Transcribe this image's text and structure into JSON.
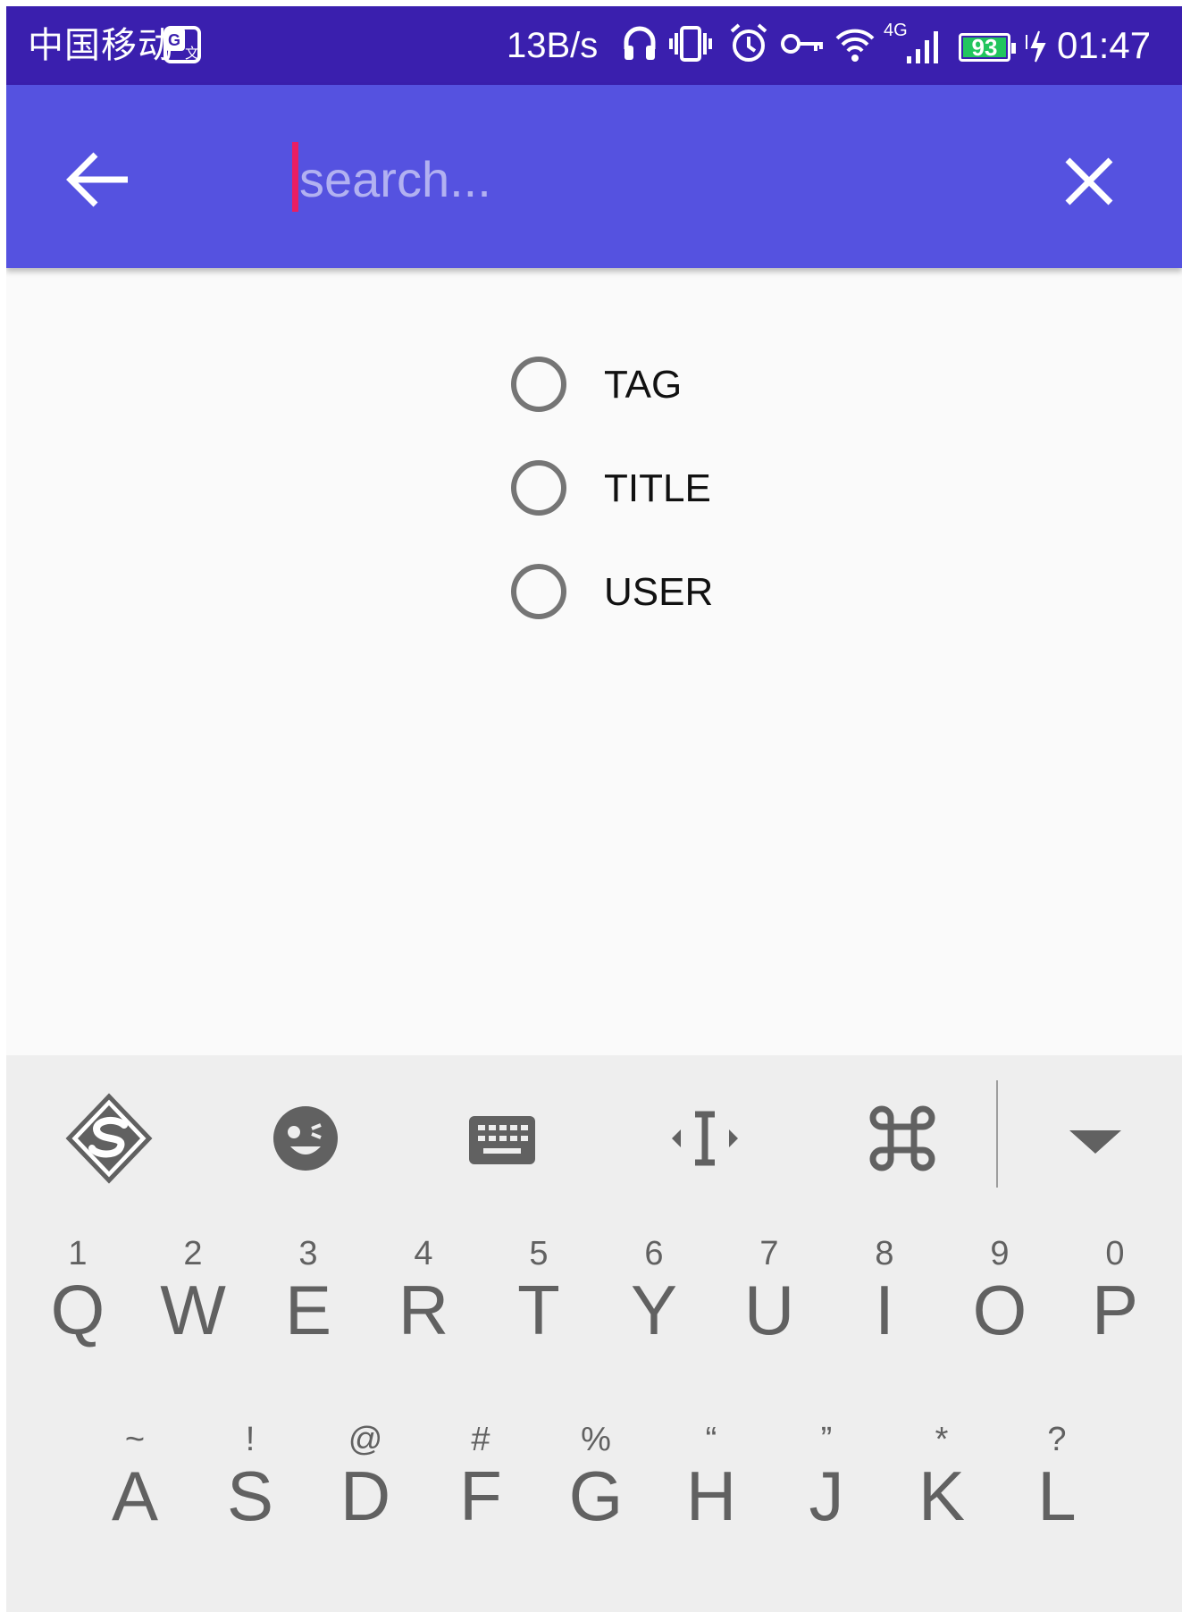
{
  "status_bar": {
    "carrier": "中国移动",
    "speed": "13B/s",
    "network": "4G",
    "battery": "93",
    "time": "01:47",
    "icons": [
      "translate-icon",
      "headphones-icon",
      "vibrate-icon",
      "alarm-icon",
      "vpn-key-icon",
      "wifi-icon",
      "signal-icon",
      "battery-icon",
      "charging-icon"
    ]
  },
  "toolbar": {
    "back_icon": "arrow-back-icon",
    "search_placeholder": "search...",
    "search_value": "",
    "clear_icon": "close-icon"
  },
  "search_types": [
    {
      "label": "TAG",
      "selected": false
    },
    {
      "label": "TITLE",
      "selected": false
    },
    {
      "label": "USER",
      "selected": false
    }
  ],
  "keyboard": {
    "toolbar_icons": [
      "sogou-logo-icon",
      "emoji-icon",
      "keyboard-icon",
      "cursor-move-icon",
      "command-icon",
      "collapse-keyboard-icon"
    ],
    "row1": [
      {
        "main": "Q",
        "sub": "1"
      },
      {
        "main": "W",
        "sub": "2"
      },
      {
        "main": "E",
        "sub": "3"
      },
      {
        "main": "R",
        "sub": "4"
      },
      {
        "main": "T",
        "sub": "5"
      },
      {
        "main": "Y",
        "sub": "6"
      },
      {
        "main": "U",
        "sub": "7"
      },
      {
        "main": "I",
        "sub": "8"
      },
      {
        "main": "O",
        "sub": "9"
      },
      {
        "main": "P",
        "sub": "0"
      }
    ],
    "row2": [
      {
        "main": "A",
        "sub": "~"
      },
      {
        "main": "S",
        "sub": "!"
      },
      {
        "main": "D",
        "sub": "@"
      },
      {
        "main": "F",
        "sub": "#"
      },
      {
        "main": "G",
        "sub": "%"
      },
      {
        "main": "H",
        "sub": "“"
      },
      {
        "main": "J",
        "sub": "”"
      },
      {
        "main": "K",
        "sub": "*"
      },
      {
        "main": "L",
        "sub": "?"
      }
    ]
  },
  "colors": {
    "status_bar": "#3a1fae",
    "toolbar": "#5552e0",
    "cursor": "#e91e63",
    "battery_fill": "#22c55e",
    "radio_ring": "#757575",
    "keyboard_bg": "#eeeeee",
    "key_text": "#616161"
  }
}
